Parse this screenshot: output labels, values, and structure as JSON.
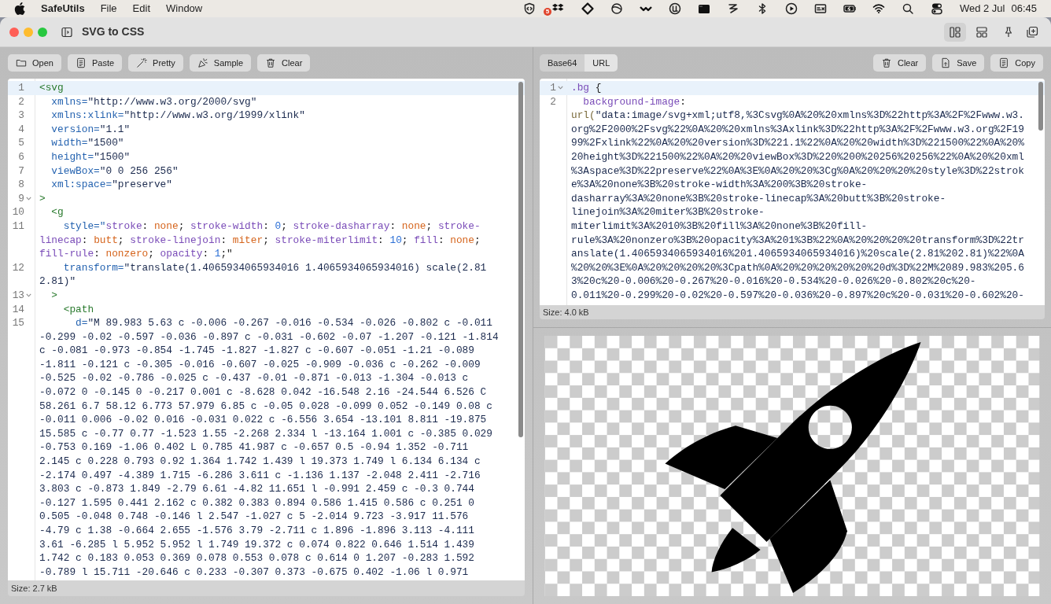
{
  "menu_bar": {
    "app_name": "SafeUtils",
    "menus": [
      "File",
      "Edit",
      "Window"
    ],
    "notification_badge": "5",
    "date": "Wed 2 Jul",
    "time": "06:45"
  },
  "window": {
    "title": "SVG to CSS",
    "layout_options": [
      {
        "selected": true
      },
      {
        "selected": false
      }
    ]
  },
  "input_panel": {
    "buttons": [
      "Open",
      "Paste",
      "Pretty",
      "Sample",
      "Clear"
    ],
    "lines": [
      {
        "number": "1",
        "foldable": false,
        "current": true,
        "tokens": [
          {
            "kind": "tag",
            "text": "<svg"
          }
        ]
      },
      {
        "number": "2",
        "foldable": false,
        "current": false,
        "tokens": [
          {
            "kind": "attr",
            "text": "  xmlns="
          },
          {
            "kind": "str",
            "text": "\"http://www.w3.org/2000/svg\""
          }
        ]
      },
      {
        "number": "3",
        "foldable": false,
        "current": false,
        "tokens": [
          {
            "kind": "attr",
            "text": "  xmlns:xlink="
          },
          {
            "kind": "str",
            "text": "\"http://www.w3.org/1999/xlink\""
          }
        ]
      },
      {
        "number": "4",
        "foldable": false,
        "current": false,
        "tokens": [
          {
            "kind": "attr",
            "text": "  version="
          },
          {
            "kind": "str",
            "text": "\"1.1\""
          }
        ]
      },
      {
        "number": "5",
        "foldable": false,
        "current": false,
        "tokens": [
          {
            "kind": "attr",
            "text": "  width="
          },
          {
            "kind": "str",
            "text": "\"1500\""
          }
        ]
      },
      {
        "number": "6",
        "foldable": false,
        "current": false,
        "tokens": [
          {
            "kind": "attr",
            "text": "  height="
          },
          {
            "kind": "str",
            "text": "\"1500\""
          }
        ]
      },
      {
        "number": "7",
        "foldable": false,
        "current": false,
        "tokens": [
          {
            "kind": "attr",
            "text": "  viewBox="
          },
          {
            "kind": "str",
            "text": "\"0 0 256 256\""
          }
        ]
      },
      {
        "number": "8",
        "foldable": false,
        "current": false,
        "tokens": [
          {
            "kind": "attr",
            "text": "  xml:space="
          },
          {
            "kind": "str",
            "text": "\"preserve\""
          }
        ]
      },
      {
        "number": "9",
        "foldable": true,
        "current": false,
        "tokens": [
          {
            "kind": "tag",
            "text": ">"
          }
        ]
      },
      {
        "number": "10",
        "foldable": false,
        "current": false,
        "tokens": [
          {
            "kind": "tag",
            "text": "  <g"
          }
        ]
      },
      {
        "number": "11",
        "foldable": false,
        "current": false,
        "tokens": [
          {
            "kind": "attr",
            "text": "    style=\""
          },
          {
            "kind": "prop",
            "text": "stroke"
          },
          {
            "kind": "plain",
            "text": ": "
          },
          {
            "kind": "kw",
            "text": "none"
          },
          {
            "kind": "plain",
            "text": "; "
          },
          {
            "kind": "prop",
            "text": "stroke-width"
          },
          {
            "kind": "plain",
            "text": ": "
          },
          {
            "kind": "num",
            "text": "0"
          },
          {
            "kind": "plain",
            "text": "; "
          },
          {
            "kind": "prop",
            "text": "stroke-dasharray"
          },
          {
            "kind": "plain",
            "text": ": "
          },
          {
            "kind": "kw",
            "text": "none"
          },
          {
            "kind": "plain",
            "text": "; "
          },
          {
            "kind": "prop",
            "text": "stroke-linecap"
          },
          {
            "kind": "plain",
            "text": ": "
          },
          {
            "kind": "kw",
            "text": "butt"
          },
          {
            "kind": "plain",
            "text": "; "
          },
          {
            "kind": "prop",
            "text": "stroke-linejoin"
          },
          {
            "kind": "plain",
            "text": ": "
          },
          {
            "kind": "kw",
            "text": "miter"
          },
          {
            "kind": "plain",
            "text": "; "
          },
          {
            "kind": "prop",
            "text": "stroke-miterlimit"
          },
          {
            "kind": "plain",
            "text": ": "
          },
          {
            "kind": "num",
            "text": "10"
          },
          {
            "kind": "plain",
            "text": "; "
          },
          {
            "kind": "prop",
            "text": "fill"
          },
          {
            "kind": "plain",
            "text": ": "
          },
          {
            "kind": "kw",
            "text": "none"
          },
          {
            "kind": "plain",
            "text": "; "
          },
          {
            "kind": "prop",
            "text": "fill-rule"
          },
          {
            "kind": "plain",
            "text": ": "
          },
          {
            "kind": "kw",
            "text": "nonzero"
          },
          {
            "kind": "plain",
            "text": "; "
          },
          {
            "kind": "prop",
            "text": "opacity"
          },
          {
            "kind": "plain",
            "text": ": "
          },
          {
            "kind": "num",
            "text": "1"
          },
          {
            "kind": "plain",
            "text": ";\""
          }
        ]
      },
      {
        "number": "12",
        "foldable": false,
        "current": false,
        "tokens": [
          {
            "kind": "attr",
            "text": "    transform="
          },
          {
            "kind": "str",
            "text": "\"translate(1.4065934065934016 1.4065934065934016) scale(2.81 2.81)\""
          }
        ]
      },
      {
        "number": "13",
        "foldable": true,
        "current": false,
        "tokens": [
          {
            "kind": "tag",
            "text": "  >"
          }
        ]
      },
      {
        "number": "14",
        "foldable": false,
        "current": false,
        "tokens": [
          {
            "kind": "tag",
            "text": "    <path"
          }
        ]
      },
      {
        "number": "15",
        "foldable": false,
        "current": false,
        "tokens": [
          {
            "kind": "attr",
            "text": "      d="
          },
          {
            "kind": "str",
            "text": "\"M 89.983 5.63 c -0.006 -0.267 -0.016 -0.534 -0.026 -0.802 c -0.011 -0.299 -0.02 -0.597 -0.036 -0.897 c -0.031 -0.602 -0.07 -1.207 -0.121 -1.814 c -0.081 -0.973 -0.854 -1.745 -1.827 -1.827 c -0.607 -0.051 -1.21 -0.089 -1.811 -0.121 c -0.305 -0.016 -0.607 -0.025 -0.909 -0.036 c -0.262 -0.009 -0.525 -0.02 -0.786 -0.025 c -0.437 -0.01 -0.871 -0.013 -1.304 -0.013 c -0.072 0 -0.145 0 -0.217 0.001 c -8.628 0.042 -16.548 2.16 -24.544 6.526 C 58.261 6.7 58.12 6.773 57.979 6.85 c -0.05 0.028 -0.099 0.052 -0.149 0.08 c -0.011 0.006 -0.02 0.016 -0.031 0.022 c -6.556 3.654 -13.101 8.811 -19.875 15.585 c -0.77 0.77 -1.523 1.55 -2.268 2.334 l -13.164 1.001 c -0.385 0.029 -0.753 0.169 -1.06 0.402 L 0.785 41.987 c -0.657 0.5 -0.94 1.352 -0.711 2.145 c 0.228 0.793 0.92 1.364 1.742 1.439 l 19.373 1.749 l 6.134 6.134 c -2.174 0.497 -4.389 1.715 -6.286 3.611 c -1.136 1.137 -2.048 2.411 -2.716 3.803 c -0.873 1.849 -2.79 6.61 -4.82 11.651 l -0.991 2.459 c -0.3 0.744 -0.127 1.595 0.441 2.162 c 0.382 0.383 0.894 0.586 1.415 0.586 c 0.251 0 0.505 -0.048 0.748 -0.146 l 2.547 -1.027 c 5 -2.014 9.723 -3.917 11.576 -4.79 c 1.38 -0.664 2.655 -1.576 3.79 -2.711 c 1.896 -1.896 3.113 -4.111 3.61 -6.285 l 5.952 5.952 l 1.749 19.372 c 0.074 0.822 0.646 1.514 1.439 1.742 c 0.183 0.053 0.369 0.078 0.553 0.078 c 0.614 0 1.207 -0.283 1.592 -0.789 l 15.711 -20.646 c 0.233 -0.307 0.373 -0.675 0.402 -1.06 l 0.971"
          }
        ]
      }
    ],
    "status": "Size: 2.7 kB"
  },
  "output_panel": {
    "tabs": [
      {
        "label": "Base64",
        "selected": false
      },
      {
        "label": "URL",
        "selected": true
      }
    ],
    "buttons": [
      "Clear",
      "Save",
      "Copy"
    ],
    "lines": [
      {
        "number": "1",
        "foldable": true,
        "current": true,
        "tokens": [
          {
            "kind": "sel",
            "text": ".bg"
          },
          {
            "kind": "plain",
            "text": " {"
          }
        ]
      },
      {
        "number": "2",
        "foldable": false,
        "current": false,
        "tokens": [
          {
            "kind": "prop",
            "text": "  background-image"
          },
          {
            "kind": "plain",
            "text": ": "
          },
          {
            "kind": "fn",
            "text": "url("
          },
          {
            "kind": "str",
            "text": "\"data:image/svg+xml;utf8,%3Csvg%0A%20%20xmlns%3D%22http%3A%2F%2Fwww.w3.org%2F2000%2Fsvg%22%0A%20%20xmlns%3Axlink%3D%22http%3A%2F%2Fwww.w3.org%2F1999%2Fxlink%22%0A%20%20version%3D%221.1%22%0A%20%20width%3D%221500%22%0A%20%20height%3D%221500%22%0A%20%20viewBox%3D%220%200%20256%20256%22%0A%20%20xml%3Aspace%3D%22preserve%22%0A%3E%0A%20%20%3Cg%0A%20%20%20%20style%3D%22stroke%3A%20none%3B%20stroke-width%3A%200%3B%20stroke-dasharray%3A%20none%3B%20stroke-linecap%3A%20butt%3B%20stroke-linejoin%3A%20miter%3B%20stroke-miterlimit%3A%2010%3B%20fill%3A%20none%3B%20fill-rule%3A%20nonzero%3B%20opacity%3A%201%3B%22%0A%20%20%20%20transform%3D%22translate(1.4065934065934016%201.4065934065934016)%20scale(2.81%202.81)%22%0A%20%20%3E%0A%20%20%20%20%3Cpath%0A%20%20%20%20%20%20d%3D%22M%2089.983%205.63%20c%20-0.006%20-0.267%20-0.016%20-0.534%20-0.026%20-0.802%20c%20-0.011%20-0.299%20-0.02%20-0.597%20-0.036%20-0.897%20c%20-0.031%20-0.602%20-"
          }
        ]
      }
    ],
    "status": "Size: 4.0 kB"
  }
}
